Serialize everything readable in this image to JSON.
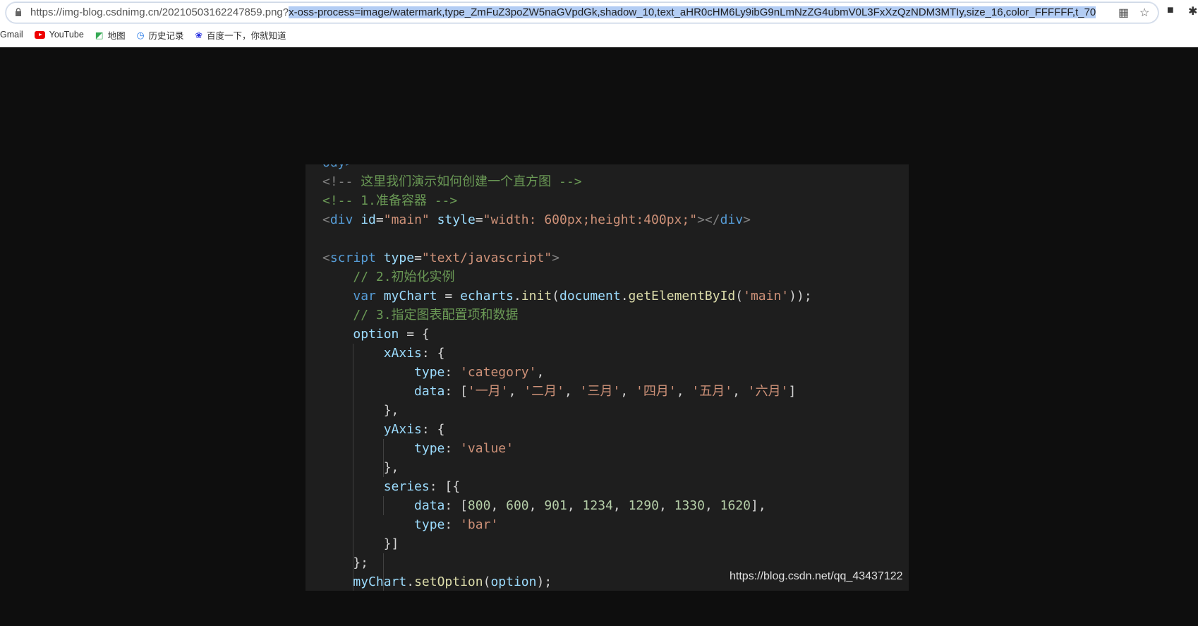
{
  "browser": {
    "url_base": "https://img-blog.csdnimg.cn/20210503162247859.png?",
    "url_selected": "x-oss-process=image/watermark,type_ZmFuZ3poZW5naGVpdGk,shadow_10,text_aHR0cHM6Ly9ibG9nLmNzZG4ubmV0L3FxXzQzNDM3MTIy,size_16,color_FFFFFF,t_70",
    "icons": [
      "lock-icon",
      "qr-code-icon",
      "star-icon",
      "extension-icon",
      "puzzle-icon"
    ],
    "bookmarks": [
      {
        "label": "Gmail",
        "icon": ""
      },
      {
        "label": "YouTube",
        "icon": "youtube-icon"
      },
      {
        "label": "地图",
        "icon": "maps-icon"
      },
      {
        "label": "历史记录",
        "icon": "history-icon"
      },
      {
        "label": "百度一下，你就知道",
        "icon": "baidu-icon"
      }
    ]
  },
  "code": {
    "lines": [
      [
        [
          "t",
          "ody>"
        ]
      ],
      [
        [
          "g",
          "<!-- "
        ],
        [
          "c",
          "这里我们演示如何创建一个直方图 -->"
        ]
      ],
      [
        [
          "c",
          "<!-- 1.准备容器 -->"
        ]
      ],
      [
        [
          "g",
          "<"
        ],
        [
          "t",
          "div "
        ],
        [
          "a",
          "id"
        ],
        [
          "p",
          "="
        ],
        [
          "s",
          "\"main\" "
        ],
        [
          "a",
          "style"
        ],
        [
          "p",
          "="
        ],
        [
          "s",
          "\"width: 600px;height:400px;\""
        ],
        [
          "g",
          "></"
        ],
        [
          "t",
          "div"
        ],
        [
          "g",
          ">"
        ]
      ],
      [],
      [
        [
          "g",
          "<"
        ],
        [
          "t",
          "script "
        ],
        [
          "a",
          "type"
        ],
        [
          "p",
          "="
        ],
        [
          "s",
          "\"text/javascript\""
        ],
        [
          "g",
          ">"
        ]
      ],
      [
        [
          "p",
          "    "
        ],
        [
          "c",
          "// 2.初始化实例"
        ]
      ],
      [
        [
          "p",
          "    "
        ],
        [
          "k",
          "var "
        ],
        [
          "a",
          "myChart"
        ],
        [
          "p",
          " = "
        ],
        [
          "a",
          "echarts"
        ],
        [
          "p",
          "."
        ],
        [
          "f",
          "init"
        ],
        [
          "p",
          "("
        ],
        [
          "a",
          "document"
        ],
        [
          "p",
          "."
        ],
        [
          "f",
          "getElementById"
        ],
        [
          "p",
          "("
        ],
        [
          "s",
          "'main'"
        ],
        [
          "p",
          "));"
        ]
      ],
      [
        [
          "p",
          "    "
        ],
        [
          "c",
          "// 3.指定图表配置项和数据"
        ]
      ],
      [
        [
          "p",
          "    "
        ],
        [
          "a",
          "option"
        ],
        [
          "p",
          " = {"
        ]
      ],
      [
        [
          "p",
          "        "
        ],
        [
          "a",
          "xAxis"
        ],
        [
          "p",
          ": {"
        ]
      ],
      [
        [
          "p",
          "            "
        ],
        [
          "a",
          "type"
        ],
        [
          "p",
          ": "
        ],
        [
          "s",
          "'category'"
        ],
        [
          "p",
          ","
        ]
      ],
      [
        [
          "p",
          "            "
        ],
        [
          "a",
          "data"
        ],
        [
          "p",
          ": ["
        ],
        [
          "s",
          "'一月'"
        ],
        [
          "p",
          ", "
        ],
        [
          "s",
          "'二月'"
        ],
        [
          "p",
          ", "
        ],
        [
          "s",
          "'三月'"
        ],
        [
          "p",
          ", "
        ],
        [
          "s",
          "'四月'"
        ],
        [
          "p",
          ", "
        ],
        [
          "s",
          "'五月'"
        ],
        [
          "p",
          ", "
        ],
        [
          "s",
          "'六月'"
        ],
        [
          "p",
          "]"
        ]
      ],
      [
        [
          "p",
          "        },"
        ]
      ],
      [
        [
          "p",
          "        "
        ],
        [
          "a",
          "yAxis"
        ],
        [
          "p",
          ": {"
        ]
      ],
      [
        [
          "p",
          "            "
        ],
        [
          "a",
          "type"
        ],
        [
          "p",
          ": "
        ],
        [
          "s",
          "'value'"
        ]
      ],
      [
        [
          "p",
          "        },"
        ]
      ],
      [
        [
          "p",
          "        "
        ],
        [
          "a",
          "series"
        ],
        [
          "p",
          ": [{"
        ]
      ],
      [
        [
          "p",
          "            "
        ],
        [
          "a",
          "data"
        ],
        [
          "p",
          ": ["
        ],
        [
          "n",
          "800"
        ],
        [
          "p",
          ", "
        ],
        [
          "n",
          "600"
        ],
        [
          "p",
          ", "
        ],
        [
          "n",
          "901"
        ],
        [
          "p",
          ", "
        ],
        [
          "n",
          "1234"
        ],
        [
          "p",
          ", "
        ],
        [
          "n",
          "1290"
        ],
        [
          "p",
          ", "
        ],
        [
          "n",
          "1330"
        ],
        [
          "p",
          ", "
        ],
        [
          "n",
          "1620"
        ],
        [
          "p",
          "],"
        ]
      ],
      [
        [
          "p",
          "            "
        ],
        [
          "a",
          "type"
        ],
        [
          "p",
          ": "
        ],
        [
          "s",
          "'bar'"
        ]
      ],
      [
        [
          "p",
          "        }]"
        ]
      ],
      [
        [
          "p",
          "    };"
        ]
      ],
      [
        [
          "p",
          "    "
        ],
        [
          "a",
          "myChart"
        ],
        [
          "p",
          "."
        ],
        [
          "f",
          "setOption"
        ],
        [
          "p",
          "("
        ],
        [
          "a",
          "option"
        ],
        [
          "p",
          ");"
        ]
      ]
    ]
  },
  "watermark": "https://blog.csdn.net/qq_43437122",
  "colors": {
    "editor_bg": "#1e1e1e",
    "comment": "#6a9955",
    "tag": "#569cd6",
    "attribute": "#9cdcfe",
    "string": "#ce9178",
    "number": "#b5cea8",
    "function": "#dcdcaa"
  }
}
